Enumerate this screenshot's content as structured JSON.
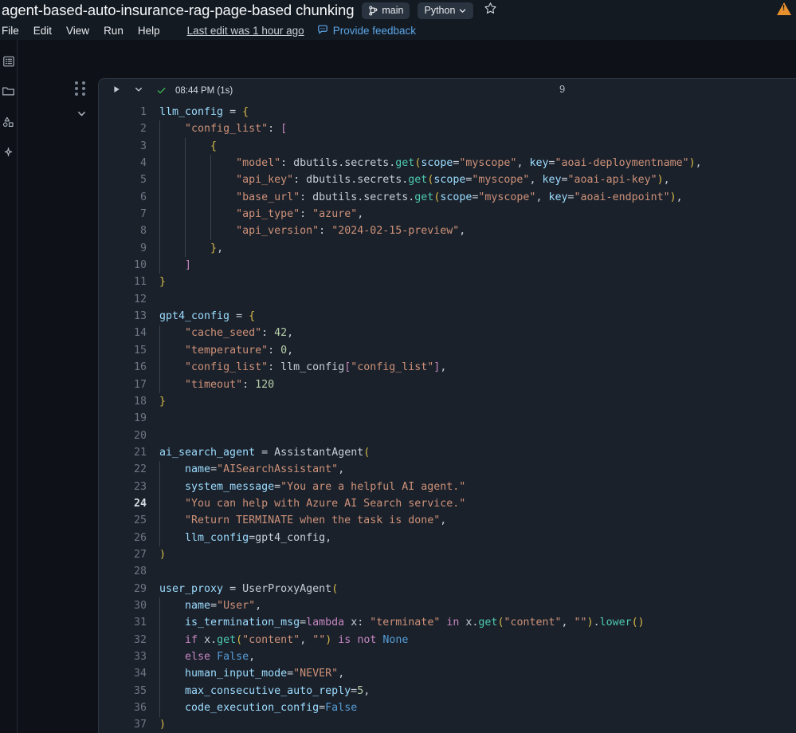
{
  "header": {
    "notebook_title": "agent-based-auto-insurance-rag-page-based chunking",
    "branch_label": "main",
    "branch_icon": "git-branch-icon",
    "language_label": "Python",
    "language_chevron_icon": "chevron-down-icon",
    "star_icon": "star-outline-icon",
    "warning_icon": "warning-triangle-icon",
    "menu": [
      "File",
      "Edit",
      "View",
      "Run",
      "Help"
    ],
    "last_edit": "Last edit was 1 hour ago",
    "feedback_label": "Provide feedback",
    "feedback_icon": "comment-icon"
  },
  "rail": {
    "items": [
      {
        "name": "sidebar-item-workspace",
        "icon": "list-panel-icon"
      },
      {
        "name": "sidebar-item-folder",
        "icon": "folder-icon"
      },
      {
        "name": "sidebar-item-catalog",
        "icon": "shapes-catalog-icon"
      },
      {
        "name": "sidebar-item-assistant",
        "icon": "sparkle-icon"
      }
    ]
  },
  "cell": {
    "run_icon": "play-icon",
    "more_icon": "chevron-down-icon",
    "status_icon": "check-icon",
    "status_text": "08:44 PM (1s)",
    "execution_count": "9",
    "grip_icon": "drag-grip-icon",
    "collapse_icon": "chevron-down-icon"
  },
  "code": {
    "language": "python",
    "lines": [
      {
        "n": "1",
        "indent": 0
      },
      {
        "n": "2",
        "indent": 1
      },
      {
        "n": "3",
        "indent": 2
      },
      {
        "n": "4",
        "indent": 3
      },
      {
        "n": "5",
        "indent": 3
      },
      {
        "n": "6",
        "indent": 3
      },
      {
        "n": "7",
        "indent": 3
      },
      {
        "n": "8",
        "indent": 3
      },
      {
        "n": "9",
        "indent": 2
      },
      {
        "n": "10",
        "indent": 1
      },
      {
        "n": "11",
        "indent": 0
      },
      {
        "n": "12",
        "indent": 0
      },
      {
        "n": "13",
        "indent": 0
      },
      {
        "n": "14",
        "indent": 1
      },
      {
        "n": "15",
        "indent": 1
      },
      {
        "n": "16",
        "indent": 1
      },
      {
        "n": "17",
        "indent": 1
      },
      {
        "n": "18",
        "indent": 0
      },
      {
        "n": "19",
        "indent": 0
      },
      {
        "n": "20",
        "indent": 0
      },
      {
        "n": "21",
        "indent": 0
      },
      {
        "n": "22",
        "indent": 1
      },
      {
        "n": "23",
        "indent": 1
      },
      {
        "n": "24",
        "indent": 1,
        "active": true
      },
      {
        "n": "25",
        "indent": 1
      },
      {
        "n": "26",
        "indent": 1
      },
      {
        "n": "27",
        "indent": 0
      },
      {
        "n": "28",
        "indent": 0
      },
      {
        "n": "29",
        "indent": 0
      },
      {
        "n": "30",
        "indent": 1
      },
      {
        "n": "31",
        "indent": 1
      },
      {
        "n": "32",
        "indent": 1
      },
      {
        "n": "33",
        "indent": 1
      },
      {
        "n": "34",
        "indent": 1
      },
      {
        "n": "35",
        "indent": 1
      },
      {
        "n": "36",
        "indent": 1
      },
      {
        "n": "37",
        "indent": 0
      }
    ],
    "text": [
      "llm_config = {",
      "    \"config_list\": [",
      "        {",
      "            \"model\": dbutils.secrets.get(scope=\"myscope\", key=\"aoai-deploymentname\"),",
      "            \"api_key\": dbutils.secrets.get(scope=\"myscope\", key=\"aoai-api-key\"),",
      "            \"base_url\": dbutils.secrets.get(scope=\"myscope\", key=\"aoai-endpoint\"),",
      "            \"api_type\": \"azure\",",
      "            \"api_version\": \"2024-02-15-preview\",",
      "        },",
      "    ]",
      "}",
      "",
      "gpt4_config = {",
      "    \"cache_seed\": 42,",
      "    \"temperature\": 0,",
      "    \"config_list\": llm_config[\"config_list\"],",
      "    \"timeout\": 120",
      "}",
      "",
      "",
      "ai_search_agent = AssistantAgent(",
      "    name=\"AISearchAssistant\",",
      "    system_message=\"You are a helpful AI agent.\"",
      "    \"You can help with Azure AI Search service.\"",
      "    \"Return TERMINATE when the task is done\",",
      "    llm_config=gpt4_config,",
      ")",
      "",
      "user_proxy = UserProxyAgent(",
      "    name=\"User\",",
      "    is_termination_msg=lambda x: \"terminate\" in x.get(\"content\", \"\").lower()",
      "    if x.get(\"content\", \"\") is not None",
      "    else False,",
      "    human_input_mode=\"NEVER\",",
      "    max_consecutive_auto_reply=5,",
      "    code_execution_config=False",
      ")"
    ]
  },
  "colors": {
    "app_bg": "#0E1117",
    "header_bg": "#131A22",
    "cell_bg": "#1A212B",
    "accent_link": "#5BA4E6",
    "success": "#3FB950",
    "warning": "#E8902C"
  }
}
